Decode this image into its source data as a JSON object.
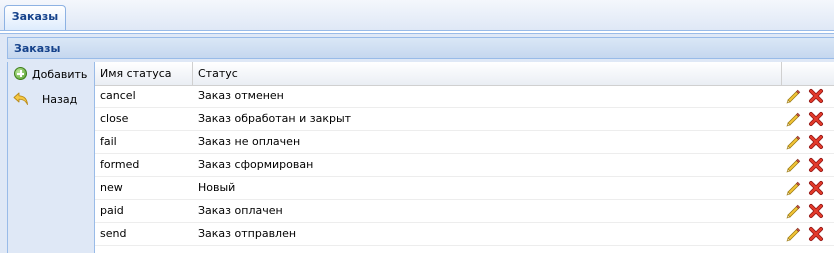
{
  "tabs": [
    {
      "label": "Заказы"
    }
  ],
  "panel": {
    "title": "Заказы"
  },
  "sidebar": {
    "add_label": "Добавить",
    "back_label": "Назад"
  },
  "grid": {
    "columns": [
      "Имя статуса",
      "Статус",
      ""
    ],
    "rows": [
      {
        "name": "cancel",
        "status": "Заказ отменен"
      },
      {
        "name": "close",
        "status": "Заказ обработан и закрыт"
      },
      {
        "name": "fail",
        "status": "Заказ не оплачен"
      },
      {
        "name": "formed",
        "status": "Заказ сформирован"
      },
      {
        "name": "new",
        "status": "Новый"
      },
      {
        "name": "paid",
        "status": "Заказ оплачен"
      },
      {
        "name": "send",
        "status": "Заказ отправлен"
      }
    ],
    "row_actions": [
      "pencil-icon",
      "delete-icon"
    ]
  },
  "colors": {
    "header_text": "#15428b",
    "panel_background": "#dfe8f6",
    "border": "#99bbe8",
    "delete": "#d42020"
  }
}
